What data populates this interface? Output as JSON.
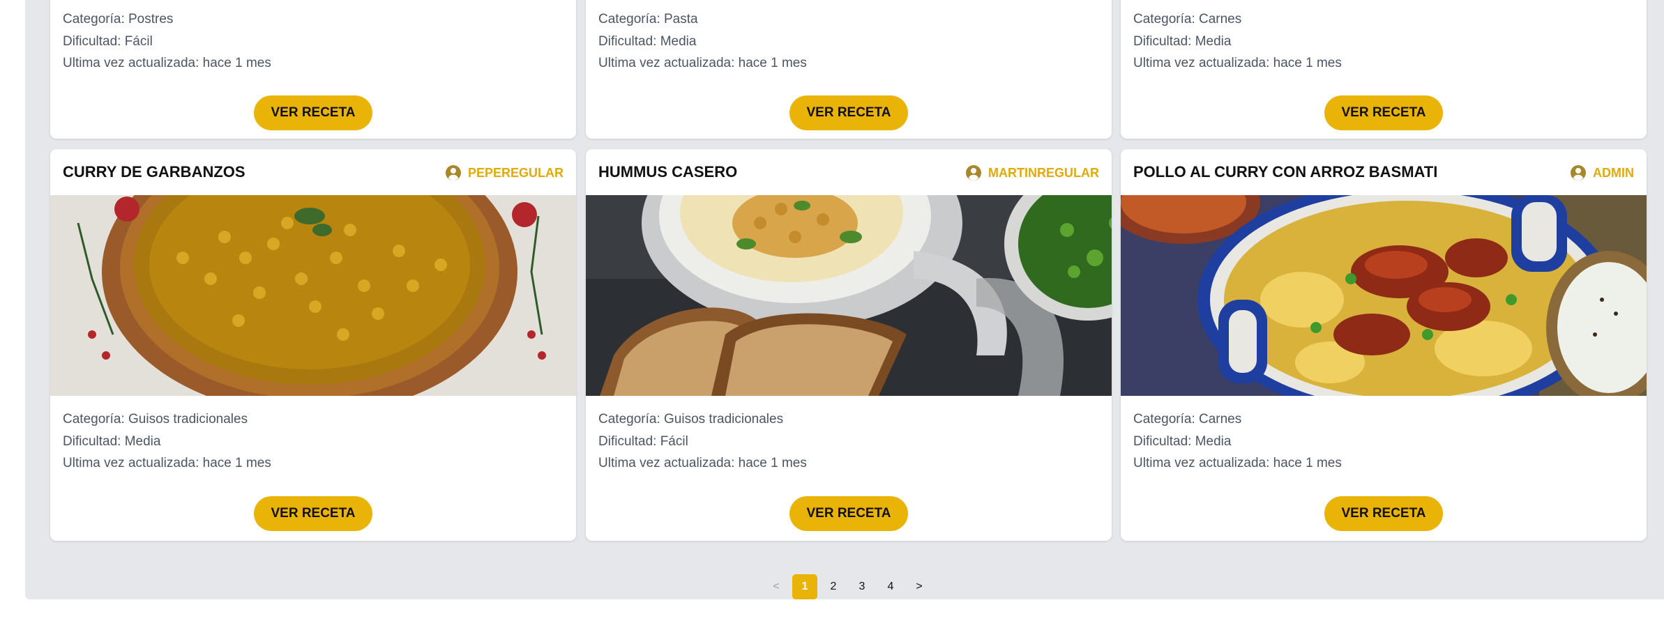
{
  "row1": [
    {
      "category": "Categoría: Postres",
      "difficulty": "Dificultad: Fácil",
      "updated": "Ultima vez actualizada: hace 1 mes",
      "button": "VER RECETA"
    },
    {
      "category": "Categoría: Pasta",
      "difficulty": "Dificultad: Media",
      "updated": "Ultima vez actualizada: hace 1 mes",
      "button": "VER RECETA"
    },
    {
      "category": "Categoría: Carnes",
      "difficulty": "Dificultad: Media",
      "updated": "Ultima vez actualizada: hace 1 mes",
      "button": "VER RECETA"
    }
  ],
  "row2": [
    {
      "title": "CURRY DE GARBANZOS",
      "author": "PEPEREGULAR",
      "image_icon": "chickpea-curry-photo",
      "category": "Categoría: Guisos tradicionales",
      "difficulty": "Dificultad: Media",
      "updated": "Ultima vez actualizada: hace 1 mes",
      "button": "VER RECETA"
    },
    {
      "title": "HUMMUS CASERO",
      "author": "MARTINREGULAR",
      "image_icon": "hummus-photo",
      "category": "Categoría: Guisos tradicionales",
      "difficulty": "Dificultad: Fácil",
      "updated": "Ultima vez actualizada: hace 1 mes",
      "button": "VER RECETA"
    },
    {
      "title": "POLLO AL CURRY CON ARROZ BASMATI",
      "author": "ADMIN",
      "image_icon": "chicken-curry-rice-photo",
      "category": "Categoría: Carnes",
      "difficulty": "Dificultad: Media",
      "updated": "Ultima vez actualizada: hace 1 mes",
      "button": "VER RECETA"
    }
  ],
  "pagination": {
    "prev": "<",
    "pages": [
      "1",
      "2",
      "3",
      "4"
    ],
    "current": "1",
    "next": ">"
  },
  "colors": {
    "accent": "#eab308",
    "author": "#e0aa08",
    "panel": "#e5e7eb"
  }
}
